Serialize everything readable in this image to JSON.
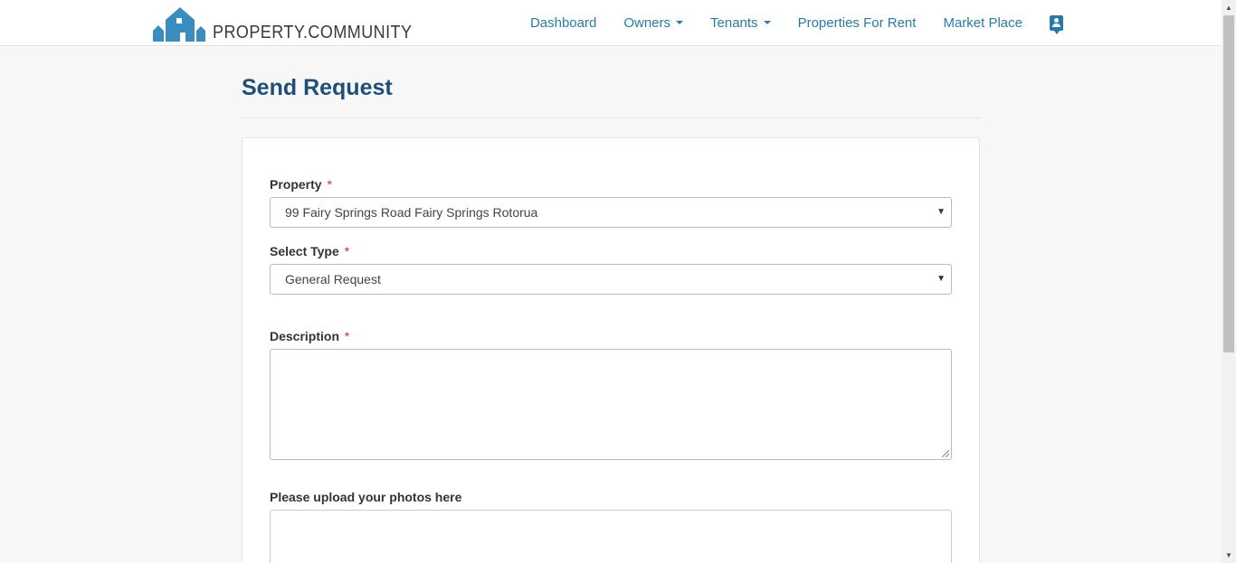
{
  "brand": {
    "name": "PROPERTY.COMMUNITY",
    "color": "#3c8dbf"
  },
  "nav": {
    "items": [
      {
        "label": "Dashboard",
        "dropdown": false
      },
      {
        "label": "Owners",
        "dropdown": true
      },
      {
        "label": "Tenants",
        "dropdown": true
      },
      {
        "label": "Properties For Rent",
        "dropdown": false
      },
      {
        "label": "Market Place",
        "dropdown": false
      }
    ],
    "contact_icon": "contact-card-icon"
  },
  "page": {
    "title": "Send Request"
  },
  "form": {
    "property": {
      "label": "Property",
      "required_mark": "*",
      "value": "99 Fairy Springs Road Fairy Springs Rotorua"
    },
    "type": {
      "label": "Select Type",
      "required_mark": "*",
      "value": "General Request"
    },
    "description": {
      "label": "Description",
      "required_mark": "*",
      "value": ""
    },
    "photos": {
      "label": "Please upload your photos here"
    }
  },
  "colors": {
    "accent": "#2a7aa8",
    "title": "#1f4e79",
    "required": "#c9302c"
  }
}
